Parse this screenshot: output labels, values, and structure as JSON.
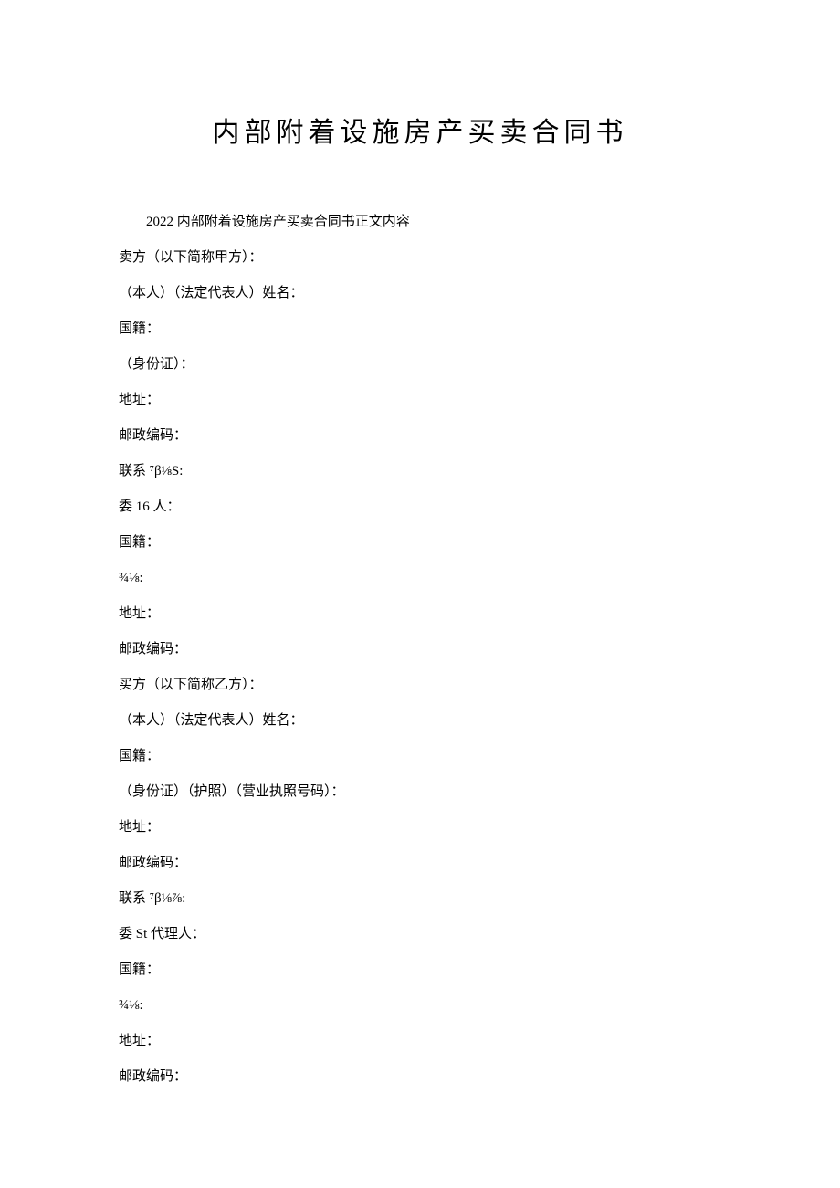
{
  "title": "内部附着设施房产买卖合同书",
  "subtitle": "2022 内部附着设施房产买卖合同书正文内容",
  "lines": [
    "卖方（以下简称甲方）：",
    "（本人）（法定代表人）姓名：",
    "国籍：",
    "（身份证）：",
    "地址：",
    "邮政编码：",
    "联系 ⁷β⅛S:",
    "委 16 人：",
    "国籍：",
    "¾⅛:",
    "地址：",
    "邮政编码：",
    "买方（以下简称乙方）：",
    "（本人）（法定代表人）姓名：",
    "国籍：",
    "（身份证）（护照）（营业执照号码）：",
    "地址：",
    "邮政编码：",
    "联系 ⁷β⅛⅞:",
    "委 St 代理人：",
    "国籍：",
    "¾⅛:",
    "地址：",
    "邮政编码："
  ]
}
